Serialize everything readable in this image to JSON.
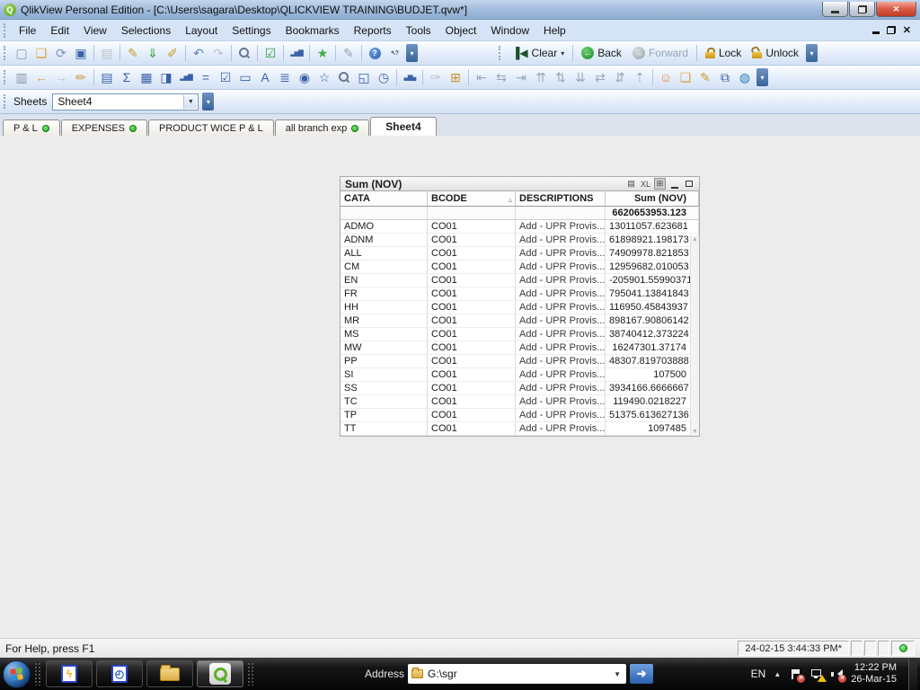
{
  "window": {
    "title": "QlikView Personal Edition - [C:\\Users\\sagara\\Desktop\\QLICKVIEW TRAINING\\BUDJET.qvw*]"
  },
  "menubar": {
    "items": [
      "File",
      "Edit",
      "View",
      "Selections",
      "Layout",
      "Settings",
      "Bookmarks",
      "Reports",
      "Tools",
      "Object",
      "Window",
      "Help"
    ]
  },
  "toolbar_main": {
    "buttons": [
      {
        "name": "new-document-icon",
        "glyph": "▢",
        "color": "#8a97a8"
      },
      {
        "name": "open-file-icon",
        "glyph": "❏",
        "color": "#d9a33c"
      },
      {
        "name": "reload-icon",
        "glyph": "⟳",
        "color": "#7d93b5"
      },
      {
        "name": "save-icon",
        "glyph": "▣",
        "color": "#3a62a8"
      },
      {
        "sep": true
      },
      {
        "name": "print-icon",
        "glyph": "▤",
        "color": "#b9c2cc",
        "disabled": true
      },
      {
        "sep": true
      },
      {
        "name": "edit-script-icon",
        "glyph": "✎",
        "color": "#c79a2e"
      },
      {
        "name": "reload-data-icon",
        "glyph": "⇓",
        "color": "#2e9e3a"
      },
      {
        "name": "partial-reload-icon",
        "glyph": "✐",
        "color": "#c79a2e"
      },
      {
        "sep": true
      },
      {
        "name": "undo-icon",
        "glyph": "↶",
        "color": "#5b7fb4"
      },
      {
        "name": "redo-icon",
        "glyph": "↷",
        "color": "#b9c2cc",
        "disabled": true
      },
      {
        "sep": true
      },
      {
        "name": "search-icon",
        "css": "mag"
      },
      {
        "sep": true
      },
      {
        "name": "current-selections-icon",
        "glyph": "☑",
        "color": "#2e9e3a"
      },
      {
        "sep": true
      },
      {
        "name": "quick-chart-icon",
        "glyph": "▂▅▇",
        "color": "#3a62a8",
        "small": true
      },
      {
        "sep": true
      },
      {
        "name": "bookmark-star-icon",
        "glyph": "★",
        "color": "#3cb043"
      },
      {
        "sep": true
      },
      {
        "name": "notes-icon",
        "glyph": "✎",
        "color": "#9aa5b1"
      },
      {
        "sep": true
      },
      {
        "name": "help-icon",
        "css": "helpico"
      },
      {
        "name": "whats-this-icon",
        "glyph": "↖?",
        "color": "#445566",
        "small": true
      }
    ],
    "right_buttons": [
      {
        "name": "clear-button",
        "label": "Clear",
        "icon": {
          "name": "clear-icon",
          "glyph": "▐◀",
          "color": "#1c4f2a",
          "small": true
        },
        "caret": true
      },
      {
        "sep": true
      },
      {
        "name": "back-button",
        "label": "Back",
        "icon": {
          "name": "back-icon",
          "css": "circ-green"
        }
      },
      {
        "name": "forward-button",
        "label": "Forward",
        "icon": {
          "name": "forward-icon",
          "css": "circ-gray"
        },
        "disabled": true
      },
      {
        "sep": true
      },
      {
        "name": "lock-button",
        "label": "Lock",
        "icon": {
          "name": "lock-icon",
          "css": "lockico"
        }
      },
      {
        "name": "unlock-button",
        "label": "Unlock",
        "icon": {
          "name": "unlock-icon",
          "css": "unlockico"
        }
      }
    ]
  },
  "toolbar_design": {
    "buttons": [
      {
        "name": "add-sheet-icon",
        "glyph": "▥",
        "color": "#8a97a8"
      },
      {
        "name": "promote-sheet-icon",
        "glyph": "←",
        "color": "#d9a33c"
      },
      {
        "name": "demote-sheet-icon",
        "glyph": "→",
        "color": "#b9c2cc",
        "disabled": true
      },
      {
        "name": "sheet-properties-icon",
        "glyph": "✏",
        "color": "#c79a2e"
      },
      {
        "sep": true
      },
      {
        "name": "create-listbox-icon",
        "glyph": "▤",
        "color": "#3a62a8"
      },
      {
        "name": "create-statistics-box-icon",
        "glyph": "Σ",
        "color": "#3a62a8"
      },
      {
        "name": "create-table-box-icon",
        "glyph": "▦",
        "color": "#3a62a8"
      },
      {
        "name": "create-input-box-icon",
        "glyph": "◨",
        "color": "#3a62a8"
      },
      {
        "name": "create-chart-icon",
        "glyph": "▂▅▇",
        "color": "#3a62a8",
        "small": true
      },
      {
        "name": "create-gauge-icon",
        "glyph": "=",
        "color": "#3a62a8"
      },
      {
        "name": "create-multi-box-icon",
        "glyph": "☑",
        "color": "#3a62a8"
      },
      {
        "name": "create-button-icon",
        "glyph": "▭",
        "color": "#3a62a8"
      },
      {
        "name": "create-text-object-icon",
        "glyph": "A",
        "color": "#3a62a8"
      },
      {
        "name": "create-slider-icon",
        "glyph": "≣",
        "color": "#3a62a8"
      },
      {
        "name": "create-current-selections-icon",
        "glyph": "◉",
        "color": "#3a62a8"
      },
      {
        "name": "create-bookmark-object-icon",
        "glyph": "☆",
        "color": "#3a62a8"
      },
      {
        "name": "create-search-object-icon",
        "css": "mag"
      },
      {
        "name": "create-container-icon",
        "glyph": "◱",
        "color": "#3a62a8"
      },
      {
        "name": "create-clock-icon",
        "glyph": "◷",
        "color": "#3a62a8"
      },
      {
        "sep": true
      },
      {
        "name": "chart-wizard-icon",
        "glyph": "▃▆▄",
        "color": "#3a62a8",
        "small": true
      },
      {
        "sep": true
      },
      {
        "name": "format-painter-icon",
        "glyph": "✑",
        "color": "#b9c2cc",
        "disabled": true
      },
      {
        "name": "design-grid-icon",
        "glyph": "⊞",
        "color": "#c7902e"
      },
      {
        "sep": true
      },
      {
        "name": "align-left-icon",
        "glyph": "⇤",
        "color": "#9aa8bb"
      },
      {
        "name": "center-horizontal-icon",
        "glyph": "⇆",
        "color": "#9aa8bb"
      },
      {
        "name": "align-right-icon",
        "glyph": "⇥",
        "color": "#9aa8bb"
      },
      {
        "name": "align-top-icon",
        "glyph": "⇈",
        "color": "#9aa8bb"
      },
      {
        "name": "center-vertical-icon",
        "glyph": "⇅",
        "color": "#9aa8bb"
      },
      {
        "name": "align-bottom-icon",
        "glyph": "⇊",
        "color": "#9aa8bb"
      },
      {
        "name": "space-horizontal-icon",
        "glyph": "⇄",
        "color": "#9aa8bb"
      },
      {
        "name": "space-vertical-icon",
        "glyph": "⇵",
        "color": "#9aa8bb"
      },
      {
        "name": "adjust-order-icon",
        "glyph": "⇡",
        "color": "#9aa8bb"
      },
      {
        "sep": true
      },
      {
        "name": "user-preferences-icon",
        "glyph": "☺",
        "color": "#e08a2e"
      },
      {
        "name": "document-properties-icon",
        "glyph": "❏",
        "color": "#d9a33c"
      },
      {
        "name": "edit-notes-icon",
        "glyph": "✎",
        "color": "#c79a2e"
      },
      {
        "name": "export-share-icon",
        "glyph": "⧉",
        "color": "#3a62a8"
      },
      {
        "name": "web-page-icon",
        "glyph": "◍",
        "color": "#2e7dbe"
      }
    ]
  },
  "sheets_bar": {
    "label": "Sheets",
    "selected": "Sheet4"
  },
  "tabs": [
    {
      "label": "P & L",
      "dot": true,
      "active": false
    },
    {
      "label": "EXPENSES",
      "dot": true,
      "active": false
    },
    {
      "label": "PRODUCT WICE P & L",
      "dot": false,
      "active": false
    },
    {
      "label": "all branch exp",
      "dot": true,
      "active": false
    },
    {
      "label": "Sheet4",
      "dot": false,
      "active": true
    }
  ],
  "table_box": {
    "caption": "Sum (NOV)",
    "caption_icons": [
      {
        "name": "print-icon",
        "glyph": "▤"
      },
      {
        "name": "excel-export-icon",
        "glyph": "XL"
      },
      {
        "name": "grid-mode-icon",
        "glyph": "⊞",
        "pressed": true
      },
      {
        "name": "minimize-icon",
        "shape": "min"
      },
      {
        "name": "maximize-icon",
        "shape": "sq"
      }
    ],
    "columns": [
      "CATA",
      "BCODE",
      "DESCRIPTIONS",
      "Sum (NOV)"
    ],
    "sort_column_index": 1,
    "sort_glyph": "▵",
    "total": "6620653953.123",
    "rows": [
      [
        "ADMO",
        "CO01",
        "Add - UPR Provis...",
        "13011057.623681"
      ],
      [
        "ADNM",
        "CO01",
        "Add - UPR Provis...",
        "61898921.198173"
      ],
      [
        "ALL",
        "CO01",
        "Add - UPR Provis...",
        "74909978.821853"
      ],
      [
        "CM",
        "CO01",
        "Add - UPR Provis...",
        "12959682.010053"
      ],
      [
        "EN",
        "CO01",
        "Add - UPR Provis...",
        "-205901.55990371"
      ],
      [
        "FR",
        "CO01",
        "Add - UPR Provis...",
        "795041.13841843"
      ],
      [
        "HH",
        "CO01",
        "Add - UPR Provis...",
        "116950.45843937"
      ],
      [
        "MR",
        "CO01",
        "Add - UPR Provis...",
        "898167.90806142"
      ],
      [
        "MS",
        "CO01",
        "Add - UPR Provis...",
        "38740412.373224"
      ],
      [
        "MW",
        "CO01",
        "Add - UPR Provis...",
        "16247301.37174"
      ],
      [
        "PP",
        "CO01",
        "Add - UPR Provis...",
        "48307.819703888"
      ],
      [
        "SI",
        "CO01",
        "Add - UPR Provis...",
        "107500"
      ],
      [
        "SS",
        "CO01",
        "Add - UPR Provis...",
        "3934166.6666667"
      ],
      [
        "TC",
        "CO01",
        "Add - UPR Provis...",
        "119490.0218227"
      ],
      [
        "TP",
        "CO01",
        "Add - UPR Provis...",
        "51375.613627136"
      ],
      [
        "TT",
        "CO01",
        "Add - UPR Provis...",
        "1097485"
      ]
    ],
    "scroll_up_glyph": "▲",
    "scroll_down_glyph": "▼"
  },
  "statusbar": {
    "help_text": "For Help, press F1",
    "timestamp": "24-02-15 3:44:33 PM*"
  },
  "taskbar": {
    "apps": [
      {
        "name": "taskbar-macro-app-button",
        "kind": "page",
        "glyph": "ϟ",
        "color": "#e8b400"
      },
      {
        "name": "taskbar-scheduler-app-button",
        "kind": "page",
        "glyph": "◴",
        "color": "#2a5fb0"
      },
      {
        "name": "taskbar-explorer-button",
        "kind": "folder"
      },
      {
        "name": "taskbar-qlikview-button",
        "kind": "qlik",
        "active": true
      }
    ],
    "address_label": "Address",
    "address_value": "G:\\sgr",
    "tray": {
      "language": "EN",
      "time": "12:22 PM",
      "date": "26-Mar-15"
    }
  },
  "colors": {
    "qlik_green": "#5fae27",
    "tab_dot_green": "#1fae1f",
    "taskbar_black": "#060607",
    "titlebar_blue": "#9db8d9"
  }
}
